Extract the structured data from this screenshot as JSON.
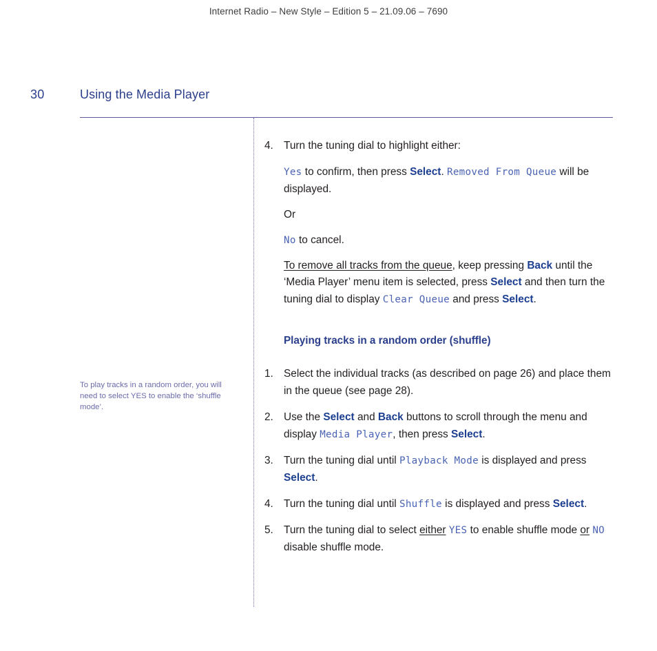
{
  "header": {
    "running_title": "Internet Radio – New Style – Edition 5 – 21.09.06 – 7690"
  },
  "page": {
    "number": "30",
    "title": "Using the Media Player"
  },
  "side_note": {
    "text": "To play tracks in a random order, you will need to select YES to enable the ‘shuffle mode’."
  },
  "content": {
    "step4": {
      "marker": "4.",
      "text": "Turn the tuning dial to highlight either:"
    },
    "yes_para": {
      "lcd_yes": "Yes",
      "t1": " to confirm, then press ",
      "btn_select": "Select",
      "t2": ". ",
      "lcd_removed": "Removed From Queue",
      "t3": " will be displayed."
    },
    "or_para": {
      "text": "Or"
    },
    "no_para": {
      "lcd_no": "No",
      "t1": " to cancel."
    },
    "remove_all_para": {
      "underlined": "To remove all tracks from the queue",
      "t1": ", keep pressing ",
      "btn_back": "Back",
      "t2": " until the ‘Media Player’ menu item is selected, press ",
      "btn_select1": "Select",
      "t3": " and then turn the tuning dial to display ",
      "lcd_clear_queue": "Clear Queue",
      "t4": " and press ",
      "btn_select2": "Select",
      "t5": "."
    },
    "section_heading": "Playing tracks in a random order (shuffle)",
    "step1": {
      "marker": "1.",
      "text": "Select the individual tracks (as described on page 26) and place them in the queue (see page 28)."
    },
    "step2": {
      "marker": "2.",
      "t1": "Use the ",
      "btn_select": "Select",
      "t2": " and ",
      "btn_back": "Back",
      "t3": " buttons to scroll through the menu and display ",
      "lcd_media_player": "Media Player",
      "t4": ", then press ",
      "btn_select2": "Select",
      "t5": "."
    },
    "step3": {
      "marker": "3.",
      "t1": "Turn the tuning dial until ",
      "lcd_playback_mode": "Playback Mode",
      "t2": " is displayed and press ",
      "btn_select": "Select",
      "t3": "."
    },
    "step4b": {
      "marker": "4.",
      "t1": "Turn the tuning dial until ",
      "lcd_shuffle": "Shuffle",
      "t2": " is displayed and press ",
      "btn_select": "Select",
      "t3": "."
    },
    "step5": {
      "marker": "5.",
      "t1": "Turn the tuning dial to select ",
      "ul_either": "either",
      "t2": " ",
      "lcd_yes": "YES",
      "t3": " to enable shuffle mode ",
      "ul_or": "or",
      "t4": " ",
      "lcd_no": "NO",
      "t5": " disable shuffle mode."
    }
  }
}
